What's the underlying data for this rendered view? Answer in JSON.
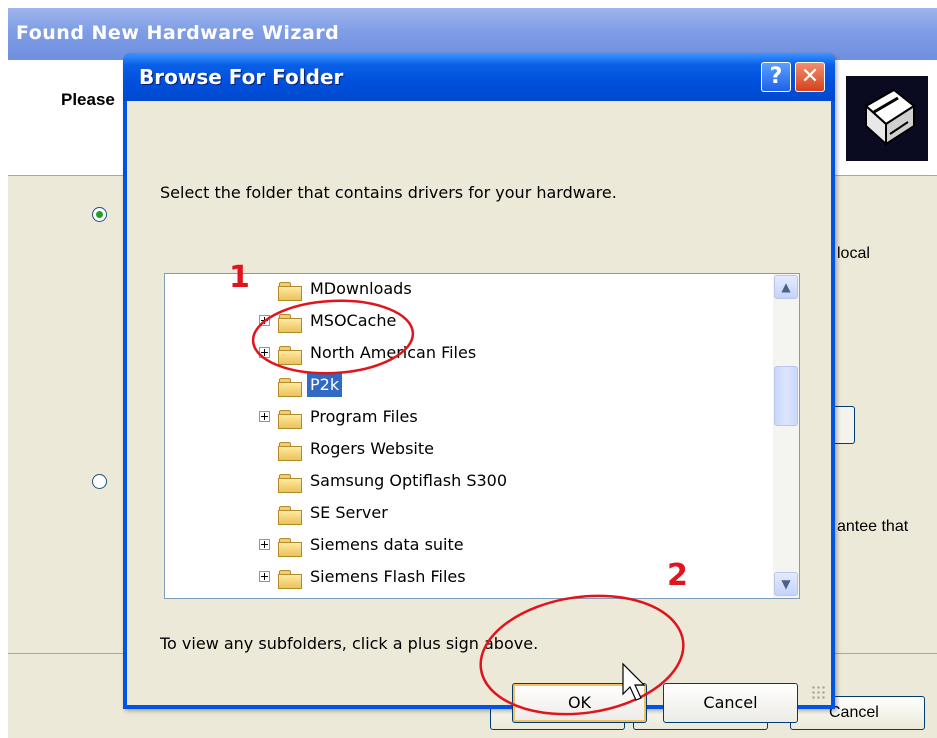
{
  "wizard": {
    "title": "Found New Hardware Wizard",
    "heading": "Please",
    "side_text_1": "local",
    "side_text_2": "antee that",
    "cancel_label": "Cancel"
  },
  "dialog": {
    "title": "Browse For Folder",
    "help_glyph": "?",
    "close_glyph": "✕",
    "instruction": "Select the folder that contains drivers for your hardware.",
    "hint": "To view any subfolders, click a plus sign above.",
    "ok_label": "OK",
    "cancel_label": "Cancel"
  },
  "tree": {
    "items": [
      {
        "label": "MDownloads",
        "expandable": false,
        "selected": false
      },
      {
        "label": "MSOCache",
        "expandable": true,
        "selected": false
      },
      {
        "label": "North American Files",
        "expandable": true,
        "selected": false
      },
      {
        "label": "P2k",
        "expandable": false,
        "selected": true
      },
      {
        "label": "Program Files",
        "expandable": true,
        "selected": false
      },
      {
        "label": "Rogers Website",
        "expandable": false,
        "selected": false
      },
      {
        "label": "Samsung Optiflash S300",
        "expandable": false,
        "selected": false
      },
      {
        "label": "SE Server",
        "expandable": false,
        "selected": false
      },
      {
        "label": "Siemens data suite",
        "expandable": true,
        "selected": false
      },
      {
        "label": "Siemens Flash Files",
        "expandable": true,
        "selected": false
      }
    ],
    "scroll_up_glyph": "▲",
    "scroll_down_glyph": "▼"
  },
  "annotations": {
    "step_1": "1",
    "step_2": "2",
    "color": "#e0141c"
  }
}
